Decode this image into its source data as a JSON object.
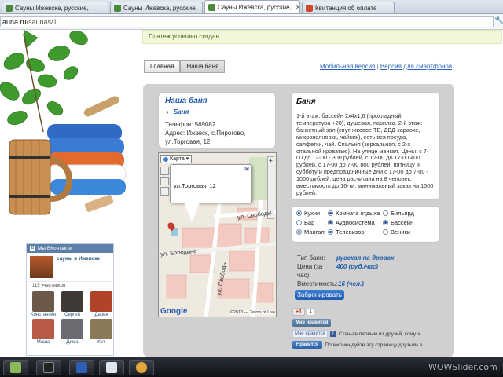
{
  "browser": {
    "tabs": [
      {
        "label": "Сауны Ижевска, русские,",
        "active": false
      },
      {
        "label": "Сауны Ижевска, русские,",
        "active": false
      },
      {
        "label": "Сауны Ижевска, русские,",
        "active": true
      },
      {
        "label": "Квитанция об оплате",
        "active": false
      }
    ],
    "url_host": "auna.ru",
    "url_path": "/saunas/1"
  },
  "notice": "Платеж успешно создан",
  "nav": {
    "tab_main": "Главная",
    "tab_ours": "Наша баня",
    "mobile_link": "Мобильная версия",
    "separator": "|",
    "smartphone_link": "Версия для смартфонов"
  },
  "sauna_card": {
    "title": "Наша баня",
    "subtitle": "Баня",
    "phone": "Телефон: 569082",
    "address_1": "Адрес: Ижевск, с.Пирогово,",
    "address_2": "ул.Торговая, 12"
  },
  "map": {
    "type_label": "Карта",
    "popup_text": "ул.Торговая, 12",
    "street_1": "ул. Свободы",
    "street_2": "ул. Бородина",
    "street_3": "ул. Свободы",
    "brand": "Google",
    "terms": "©2013 — Terms of Use"
  },
  "description": {
    "title": "Баня",
    "text": "1-й этаж: бассейн 2х4х1,6 (прохладный, температура +20), душевая, парилка. 2-й этаж: банкетный зал (спутниковое ТВ, ДВД-караоке, микроволновка, чайник), есть вся посуда, салфетки, чай. Спальня (зеркальная, с 2-х спальной кроватью). На улице мангал. Цены: с 7-00 до 12-00 - 300 рублей, с 12-00 до 17-00 400 рублей, с 17-00 до 7-00 800 рублей, пятницу и субботу и предпраздничные дни с 17-00 до 7-00 - 1000 рублей, цена расчитана на 8 человек, вместимость до 16-ти, минимальный заказ на 1500 рублей."
  },
  "features": [
    {
      "label": "Кухня",
      "on": true
    },
    {
      "label": "Комната отдыха",
      "on": true
    },
    {
      "label": "Бильярд",
      "on": false
    },
    {
      "label": "Бар",
      "on": false
    },
    {
      "label": "Аудиосистема",
      "on": true
    },
    {
      "label": "Бассейн",
      "on": true
    },
    {
      "label": "Мангал",
      "on": true
    },
    {
      "label": "Телевизор",
      "on": true
    },
    {
      "label": "Веники",
      "on": false
    }
  ],
  "info": {
    "type_key": "Тип бани:",
    "type_val": "русская на дровах",
    "price_key_1": "Цена (за",
    "price_key_2": "час):",
    "price_val": "400 (руб./час)",
    "cap_key": "Вместимость:",
    "cap_val": "16 (чел.)"
  },
  "book_button": "Забронировать",
  "social": {
    "gplus": "+1",
    "gplus_count": "1",
    "vk_like": "Мне нравится",
    "fb_like": "Мне нравится",
    "fb_text": "Станьте первым из друзей, кому э",
    "ok_like": "Нравится",
    "ok_text": "Порекомендуйте эту страницу друзьям в"
  },
  "vk_widget": {
    "header": "Мы ВКонтакте",
    "group_name": "сауны в Ижевске",
    "members_count": "115 участников",
    "members": [
      {
        "name": "Константин",
        "color": "#6b5a4a"
      },
      {
        "name": "Сергей",
        "color": "#3f3a36"
      },
      {
        "name": "Дарья",
        "color": "#b0432a"
      },
      {
        "name": "Маша",
        "color": "#b85a48"
      },
      {
        "name": "Дима",
        "color": "#6e6a72"
      },
      {
        "name": "Кот",
        "color": "#8a7a58"
      }
    ]
  },
  "watermark": {
    "a": "WOW",
    "b": "Slider.com"
  }
}
